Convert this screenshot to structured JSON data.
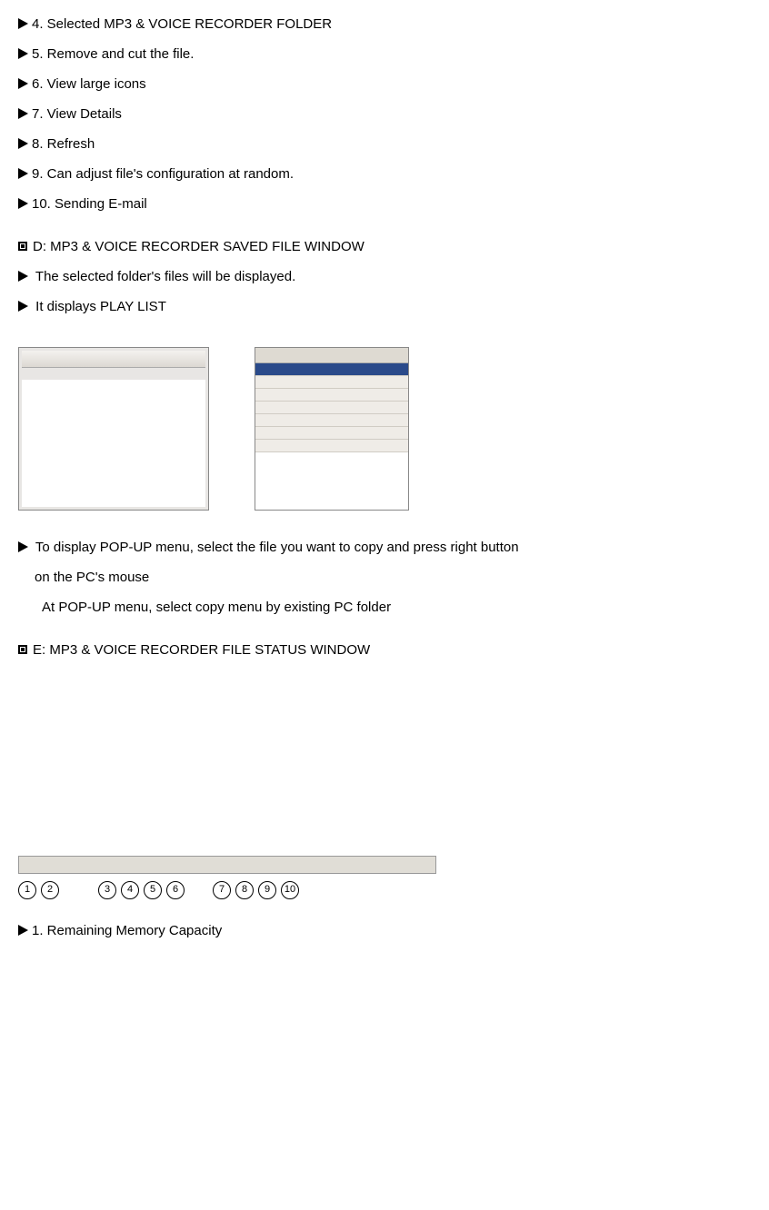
{
  "lines": {
    "l4": "4. Selected MP3 & VOICE RECORDER FOLDER",
    "l5": "5. Remove and cut the file.",
    "l6": "6. View large icons",
    "l7": "7. View Details",
    "l8": "8. Refresh",
    "l9": "9. Can adjust file's configuration at random.",
    "l10": "10. Sending E-mail"
  },
  "sectionD": {
    "title": "D: MP3 & VOICE RECORDER SAVED FILE WINDOW",
    "b1": "The selected folder's files will be displayed.",
    "b2": "It displays PLAY LIST",
    "b3": "To display POP-UP menu, select the file you want to copy and press right button",
    "b3_cont": "on the PC's mouse",
    "b3_note": "At POP-UP menu, select copy menu by existing PC folder"
  },
  "sectionE": {
    "title": "E: MP3 & VOICE RECORDER FILE STATUS WINDOW"
  },
  "status": {
    "label1": "1. Remaining Memory Capacity",
    "circled": [
      "1",
      "2",
      "3",
      "4",
      "5",
      "6",
      "7",
      "8",
      "9",
      "10"
    ]
  }
}
